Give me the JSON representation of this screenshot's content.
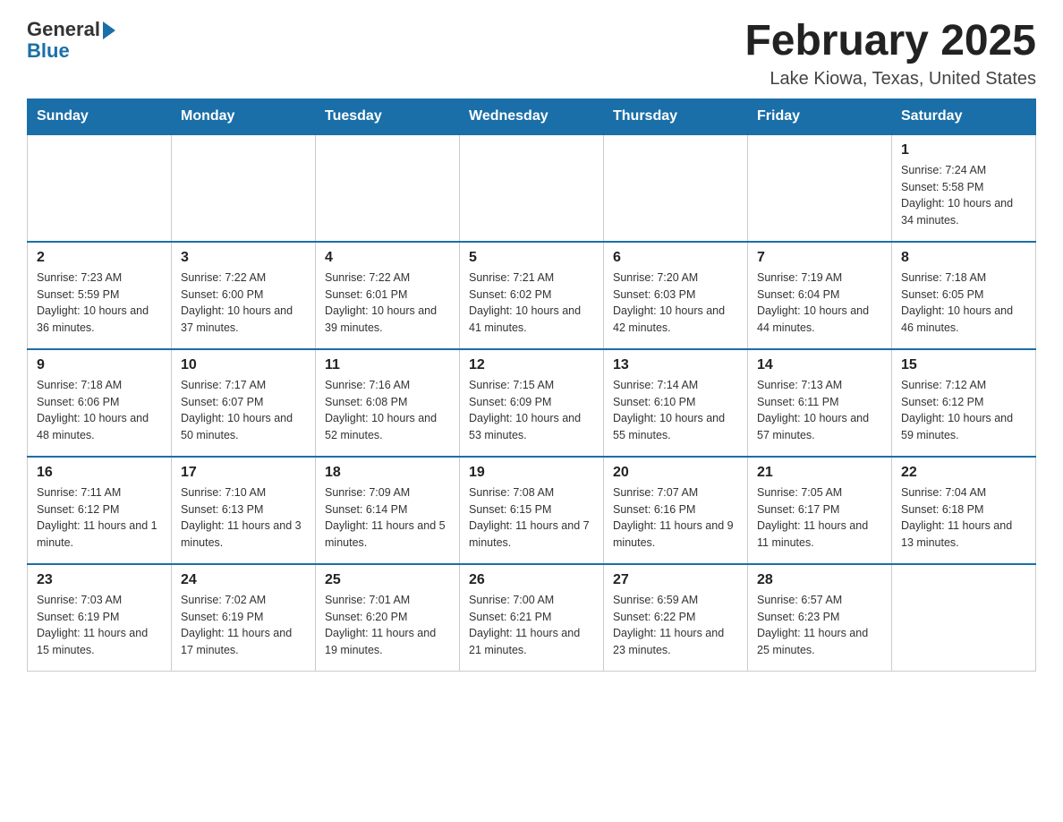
{
  "logo": {
    "general": "General",
    "blue": "Blue"
  },
  "title": "February 2025",
  "location": "Lake Kiowa, Texas, United States",
  "weekdays": [
    "Sunday",
    "Monday",
    "Tuesday",
    "Wednesday",
    "Thursday",
    "Friday",
    "Saturday"
  ],
  "weeks": [
    [
      {
        "day": "",
        "info": ""
      },
      {
        "day": "",
        "info": ""
      },
      {
        "day": "",
        "info": ""
      },
      {
        "day": "",
        "info": ""
      },
      {
        "day": "",
        "info": ""
      },
      {
        "day": "",
        "info": ""
      },
      {
        "day": "1",
        "info": "Sunrise: 7:24 AM\nSunset: 5:58 PM\nDaylight: 10 hours and 34 minutes."
      }
    ],
    [
      {
        "day": "2",
        "info": "Sunrise: 7:23 AM\nSunset: 5:59 PM\nDaylight: 10 hours and 36 minutes."
      },
      {
        "day": "3",
        "info": "Sunrise: 7:22 AM\nSunset: 6:00 PM\nDaylight: 10 hours and 37 minutes."
      },
      {
        "day": "4",
        "info": "Sunrise: 7:22 AM\nSunset: 6:01 PM\nDaylight: 10 hours and 39 minutes."
      },
      {
        "day": "5",
        "info": "Sunrise: 7:21 AM\nSunset: 6:02 PM\nDaylight: 10 hours and 41 minutes."
      },
      {
        "day": "6",
        "info": "Sunrise: 7:20 AM\nSunset: 6:03 PM\nDaylight: 10 hours and 42 minutes."
      },
      {
        "day": "7",
        "info": "Sunrise: 7:19 AM\nSunset: 6:04 PM\nDaylight: 10 hours and 44 minutes."
      },
      {
        "day": "8",
        "info": "Sunrise: 7:18 AM\nSunset: 6:05 PM\nDaylight: 10 hours and 46 minutes."
      }
    ],
    [
      {
        "day": "9",
        "info": "Sunrise: 7:18 AM\nSunset: 6:06 PM\nDaylight: 10 hours and 48 minutes."
      },
      {
        "day": "10",
        "info": "Sunrise: 7:17 AM\nSunset: 6:07 PM\nDaylight: 10 hours and 50 minutes."
      },
      {
        "day": "11",
        "info": "Sunrise: 7:16 AM\nSunset: 6:08 PM\nDaylight: 10 hours and 52 minutes."
      },
      {
        "day": "12",
        "info": "Sunrise: 7:15 AM\nSunset: 6:09 PM\nDaylight: 10 hours and 53 minutes."
      },
      {
        "day": "13",
        "info": "Sunrise: 7:14 AM\nSunset: 6:10 PM\nDaylight: 10 hours and 55 minutes."
      },
      {
        "day": "14",
        "info": "Sunrise: 7:13 AM\nSunset: 6:11 PM\nDaylight: 10 hours and 57 minutes."
      },
      {
        "day": "15",
        "info": "Sunrise: 7:12 AM\nSunset: 6:12 PM\nDaylight: 10 hours and 59 minutes."
      }
    ],
    [
      {
        "day": "16",
        "info": "Sunrise: 7:11 AM\nSunset: 6:12 PM\nDaylight: 11 hours and 1 minute."
      },
      {
        "day": "17",
        "info": "Sunrise: 7:10 AM\nSunset: 6:13 PM\nDaylight: 11 hours and 3 minutes."
      },
      {
        "day": "18",
        "info": "Sunrise: 7:09 AM\nSunset: 6:14 PM\nDaylight: 11 hours and 5 minutes."
      },
      {
        "day": "19",
        "info": "Sunrise: 7:08 AM\nSunset: 6:15 PM\nDaylight: 11 hours and 7 minutes."
      },
      {
        "day": "20",
        "info": "Sunrise: 7:07 AM\nSunset: 6:16 PM\nDaylight: 11 hours and 9 minutes."
      },
      {
        "day": "21",
        "info": "Sunrise: 7:05 AM\nSunset: 6:17 PM\nDaylight: 11 hours and 11 minutes."
      },
      {
        "day": "22",
        "info": "Sunrise: 7:04 AM\nSunset: 6:18 PM\nDaylight: 11 hours and 13 minutes."
      }
    ],
    [
      {
        "day": "23",
        "info": "Sunrise: 7:03 AM\nSunset: 6:19 PM\nDaylight: 11 hours and 15 minutes."
      },
      {
        "day": "24",
        "info": "Sunrise: 7:02 AM\nSunset: 6:19 PM\nDaylight: 11 hours and 17 minutes."
      },
      {
        "day": "25",
        "info": "Sunrise: 7:01 AM\nSunset: 6:20 PM\nDaylight: 11 hours and 19 minutes."
      },
      {
        "day": "26",
        "info": "Sunrise: 7:00 AM\nSunset: 6:21 PM\nDaylight: 11 hours and 21 minutes."
      },
      {
        "day": "27",
        "info": "Sunrise: 6:59 AM\nSunset: 6:22 PM\nDaylight: 11 hours and 23 minutes."
      },
      {
        "day": "28",
        "info": "Sunrise: 6:57 AM\nSunset: 6:23 PM\nDaylight: 11 hours and 25 minutes."
      },
      {
        "day": "",
        "info": ""
      }
    ]
  ]
}
